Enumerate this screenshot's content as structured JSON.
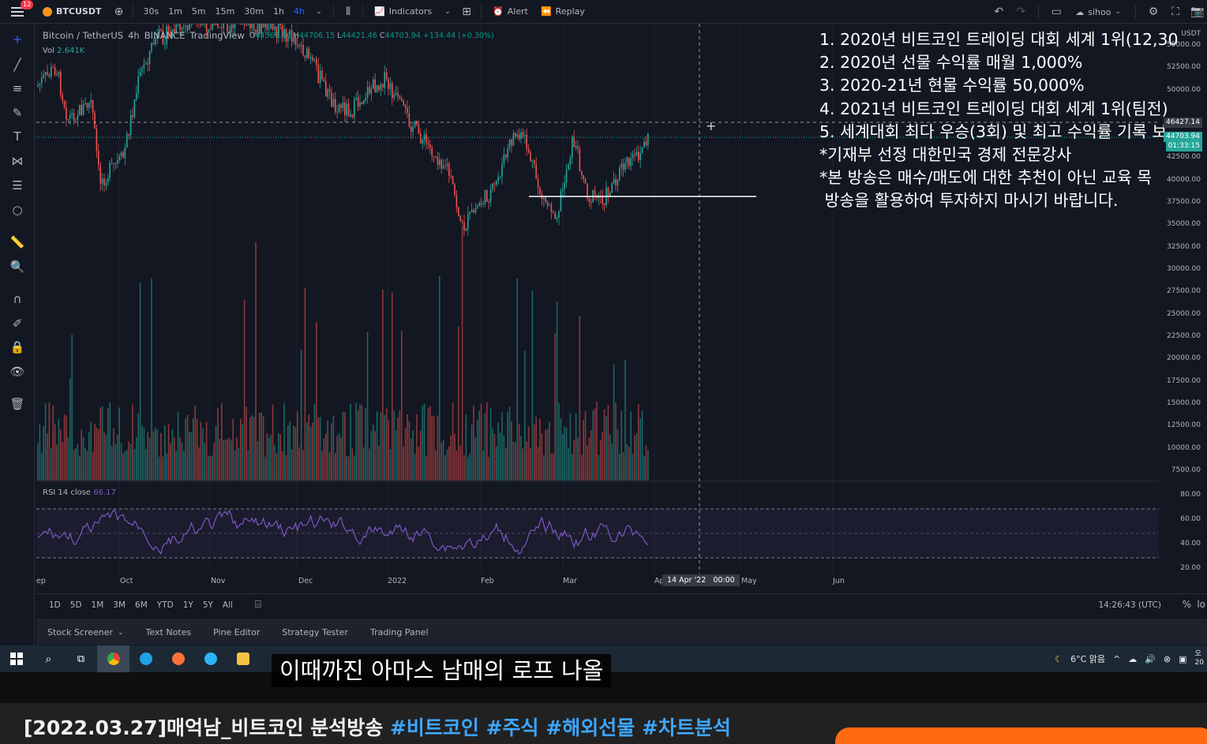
{
  "topbar": {
    "notif_count": "12",
    "symbol": "BTCUSDT",
    "intervals": [
      "30s",
      "1m",
      "5m",
      "15m",
      "30m",
      "1h",
      "4h"
    ],
    "active_interval": "4h",
    "indicators_label": "Indicators",
    "alert_label": "Alert",
    "replay_label": "Replay",
    "user_label": "sihoo"
  },
  "legend": {
    "title": "Bitcoin / TetherUS",
    "interval": "4h",
    "exchange": "BINANCE",
    "source": "TradingView",
    "open_k": "O",
    "open": "44569.50",
    "high_k": "H",
    "high": "44706.15",
    "low_k": "L",
    "low": "44421.46",
    "close_k": "C",
    "close": "44703.94",
    "change": "+134.44 (+0.30%)"
  },
  "volume": {
    "label": "Vol",
    "value": "2.641K"
  },
  "rsi": {
    "label": "RSI 14 close",
    "value": "66.17"
  },
  "overlay_lines": [
    "1. 2020년 비트코인 트레이딩 대회 세계 1위(12,30",
    "2. 2020년 선물 수익률 매월 1,000%",
    "3. 2020-21년 현물 수익률 50,000%",
    "4. 2021년 비트코인 트레이딩 대회 세계 1위(팀전)",
    "5. 세계대회 최다 우승(3회) 및 최고 수익률 기록 보",
    "*기재부 선정 대한민국 경제 전문강사",
    "*본 방송은 매수/매도에 대한 추천이 아닌 교육 목",
    " 방송을 활용하여 투자하지 마시기 바랍니다."
  ],
  "price_axis": {
    "currency": "USDT",
    "labels": [
      "55000.00",
      "52500.00",
      "50000.00",
      "42500.00",
      "40000.00",
      "37500.00",
      "35000.00",
      "32500.00",
      "30000.00",
      "27500.00",
      "25000.00",
      "22500.00",
      "20000.00",
      "17500.00",
      "15000.00",
      "12500.00",
      "10000.00",
      "7500.00"
    ],
    "crosshair_price": "46427.14",
    "last_price": "44703.94",
    "countdown": "01:33:15",
    "rsi_labels": [
      "80.00",
      "60.00",
      "40.00",
      "20.00"
    ]
  },
  "time_axis": {
    "labels": [
      "ep",
      "Oct",
      "Nov",
      "Dec",
      "2022",
      "Feb",
      "Mar",
      "Ap",
      "May",
      "Jun"
    ],
    "crosshair_date": "14 Apr '22",
    "crosshair_time": "00:00"
  },
  "range_bar": {
    "ranges": [
      "1D",
      "5D",
      "1M",
      "3M",
      "6M",
      "YTD",
      "1Y",
      "5Y",
      "All"
    ],
    "clock": "14:26:43 (UTC)",
    "pct": "%",
    "log": "lo"
  },
  "bottom_tabs": [
    "Stock Screener",
    "Text Notes",
    "Pine Editor",
    "Strategy Tester",
    "Trading Panel"
  ],
  "taskbar": {
    "weather": "6°C 맑음",
    "lang": "오",
    "year_frag": "20"
  },
  "subtitle": "이때까진 아마스 남매의 로프 나올",
  "video": {
    "title": "[2022.03.27]매억남_비트코인 분석방송 ",
    "tags": [
      "#비트코인",
      "#주식",
      "#해외선물",
      "#차트분석"
    ]
  },
  "colors": {
    "up": "#26a69a",
    "down": "#ef5350",
    "rsi": "#7e57c2",
    "accent": "#2962ff",
    "youtube_orange": "#ff6a13"
  }
}
